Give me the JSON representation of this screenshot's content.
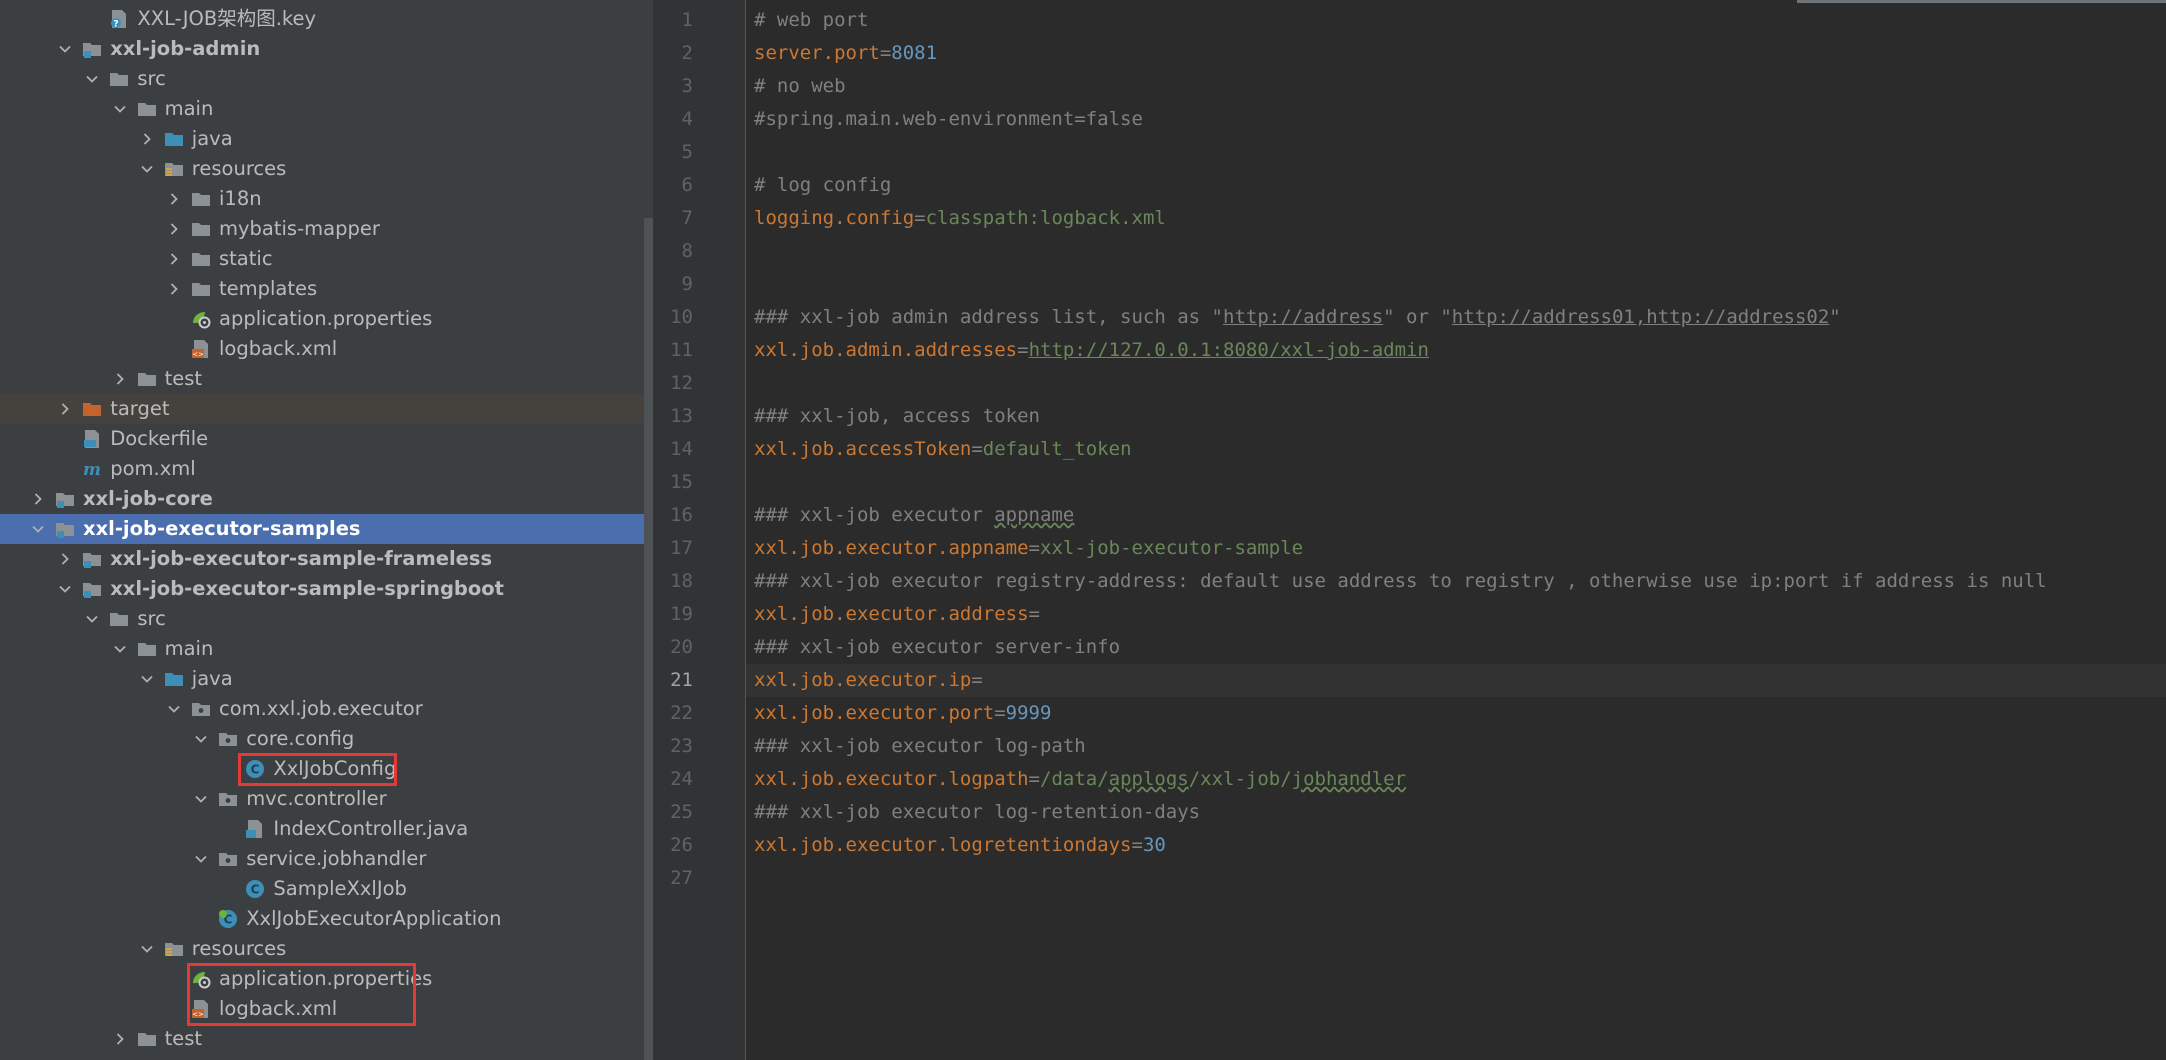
{
  "tree": {
    "items": [
      {
        "label": "XXL-JOB架构图.key",
        "icon": "keynote-file-icon",
        "chevron": "none",
        "bold": false
      },
      {
        "label": "xxl-job-admin",
        "icon": "module-folder-icon",
        "chevron": "down",
        "bold": true
      },
      {
        "label": "src",
        "icon": "folder-icon",
        "chevron": "down",
        "bold": false
      },
      {
        "label": "main",
        "icon": "folder-icon",
        "chevron": "down",
        "bold": false
      },
      {
        "label": "java",
        "icon": "source-folder-icon",
        "chevron": "right",
        "bold": false
      },
      {
        "label": "resources",
        "icon": "resources-folder-icon",
        "chevron": "down",
        "bold": false
      },
      {
        "label": "i18n",
        "icon": "folder-icon",
        "chevron": "right",
        "bold": false
      },
      {
        "label": "mybatis-mapper",
        "icon": "folder-icon",
        "chevron": "right",
        "bold": false
      },
      {
        "label": "static",
        "icon": "folder-icon",
        "chevron": "right",
        "bold": false
      },
      {
        "label": "templates",
        "icon": "folder-icon",
        "chevron": "right",
        "bold": false
      },
      {
        "label": "application.properties",
        "icon": "spring-properties-icon",
        "chevron": "none",
        "bold": false
      },
      {
        "label": "logback.xml",
        "icon": "xml-file-icon",
        "chevron": "none",
        "bold": false
      },
      {
        "label": "test",
        "icon": "folder-icon",
        "chevron": "right",
        "bold": false
      },
      {
        "label": "target",
        "icon": "excluded-folder-icon",
        "chevron": "right",
        "bold": false
      },
      {
        "label": "Dockerfile",
        "icon": "dockerfile-icon",
        "chevron": "none",
        "bold": false
      },
      {
        "label": "pom.xml",
        "icon": "maven-icon",
        "chevron": "none",
        "bold": false
      },
      {
        "label": "xxl-job-core",
        "icon": "module-folder-icon",
        "chevron": "right",
        "bold": true
      },
      {
        "label": "xxl-job-executor-samples",
        "icon": "module-folder-icon",
        "chevron": "down",
        "bold": true
      },
      {
        "label": "xxl-job-executor-sample-frameless",
        "icon": "module-folder-icon",
        "chevron": "right",
        "bold": true
      },
      {
        "label": "xxl-job-executor-sample-springboot",
        "icon": "module-folder-icon",
        "chevron": "down",
        "bold": true
      },
      {
        "label": "src",
        "icon": "folder-icon",
        "chevron": "down",
        "bold": false
      },
      {
        "label": "main",
        "icon": "folder-icon",
        "chevron": "down",
        "bold": false
      },
      {
        "label": "java",
        "icon": "source-folder-icon",
        "chevron": "down",
        "bold": false
      },
      {
        "label": "com.xxl.job.executor",
        "icon": "package-icon",
        "chevron": "down",
        "bold": false
      },
      {
        "label": "core.config",
        "icon": "package-icon",
        "chevron": "down",
        "bold": false
      },
      {
        "label": "XxlJobConfig",
        "icon": "java-class-icon",
        "chevron": "none",
        "bold": false
      },
      {
        "label": "mvc.controller",
        "icon": "package-icon",
        "chevron": "down",
        "bold": false
      },
      {
        "label": "IndexController.java",
        "icon": "java-file-icon",
        "chevron": "none",
        "bold": false
      },
      {
        "label": "service.jobhandler",
        "icon": "package-icon",
        "chevron": "down",
        "bold": false
      },
      {
        "label": "SampleXxlJob",
        "icon": "java-class-icon",
        "chevron": "none",
        "bold": false
      },
      {
        "label": "XxlJobExecutorApplication",
        "icon": "spring-boot-class-icon",
        "chevron": "none",
        "bold": false
      },
      {
        "label": "resources",
        "icon": "resources-folder-icon",
        "chevron": "down",
        "bold": false
      },
      {
        "label": "application.properties",
        "icon": "spring-properties-icon",
        "chevron": "none",
        "bold": false
      },
      {
        "label": "logback.xml",
        "icon": "xml-file-icon",
        "chevron": "none",
        "bold": false
      },
      {
        "label": "test",
        "icon": "folder-icon",
        "chevron": "right",
        "bold": false
      }
    ]
  },
  "editor": {
    "current_line": 21,
    "lines": [
      [
        [
          "# web port",
          "com"
        ]
      ],
      [
        [
          "server.port",
          "key"
        ],
        [
          "=",
          "eq"
        ],
        [
          "8081",
          "num"
        ]
      ],
      [
        [
          "# no web",
          "com"
        ]
      ],
      [
        [
          "#spring.main.web-environment=false",
          "com"
        ]
      ],
      [],
      [
        [
          "# log config",
          "com"
        ]
      ],
      [
        [
          "logging.config",
          "key"
        ],
        [
          "=",
          "eq"
        ],
        [
          "classpath:logback.xml",
          "str"
        ]
      ],
      [],
      [],
      [
        [
          "### xxl-job admin address list, such as \"",
          "com"
        ],
        [
          "http://address",
          "curl"
        ],
        [
          "\" or \"",
          "com"
        ],
        [
          "http://address01,http://address02",
          "curl"
        ],
        [
          "\"",
          "com"
        ]
      ],
      [
        [
          "xxl.job.admin.addresses",
          "key"
        ],
        [
          "=",
          "eq"
        ],
        [
          "http://127.0.0.1:8080/xxl-job-admin",
          "url"
        ]
      ],
      [],
      [
        [
          "### xxl-job, access token",
          "com"
        ]
      ],
      [
        [
          "xxl.job.accessToken",
          "key"
        ],
        [
          "=",
          "eq"
        ],
        [
          "default_token",
          "str"
        ]
      ],
      [],
      [
        [
          "### xxl-job executor ",
          "com"
        ],
        [
          "appname",
          "comtypo"
        ]
      ],
      [
        [
          "xxl.job.executor.appname",
          "key"
        ],
        [
          "=",
          "eq"
        ],
        [
          "xxl-job-executor-sample",
          "str"
        ]
      ],
      [
        [
          "### xxl-job executor registry-address: default use address to registry , otherwise use ip:port if address is null",
          "com"
        ]
      ],
      [
        [
          "xxl.job.executor.address",
          "key"
        ],
        [
          "=",
          "eq"
        ]
      ],
      [
        [
          "### xxl-job executor server-info",
          "com"
        ]
      ],
      [
        [
          "xxl.job.executor.ip",
          "key"
        ],
        [
          "=",
          "eq"
        ]
      ],
      [
        [
          "xxl.job.executor.port",
          "key"
        ],
        [
          "=",
          "eq"
        ],
        [
          "9999",
          "num"
        ]
      ],
      [
        [
          "### xxl-job executor log-path",
          "com"
        ]
      ],
      [
        [
          "xxl.job.executor.logpath",
          "key"
        ],
        [
          "=",
          "eq"
        ],
        [
          "/data/",
          "str"
        ],
        [
          "applogs",
          "strtypo"
        ],
        [
          "/xxl-job/",
          "str"
        ],
        [
          "jobhandler",
          "strtypo"
        ]
      ],
      [
        [
          "### xxl-job executor log-retention-days",
          "com"
        ]
      ],
      [
        [
          "xxl.job.executor.logretentiondays",
          "key"
        ],
        [
          "=",
          "eq"
        ],
        [
          "30",
          "num"
        ]
      ],
      []
    ]
  }
}
